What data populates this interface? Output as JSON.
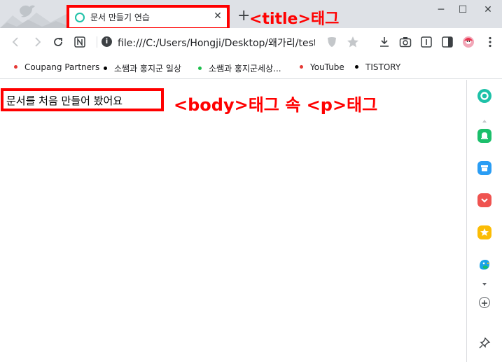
{
  "tab": {
    "title": "문서 만들기 연습",
    "close": "✕"
  },
  "new_tab": "+",
  "annotations": {
    "title_tag": "<title>태그",
    "body_tag": "<body>태그 속 <p>태그"
  },
  "window": {
    "minimize": "─",
    "maximize": "☐",
    "close": "✕"
  },
  "toolbar": {
    "url": "file:///C:/Users/Hongji/Desktop/왜가리/test.h"
  },
  "bookmarks": [
    {
      "label": "Coupang Partners",
      "color": "#e53935"
    },
    {
      "label": "소쌤과 홍지군 일상",
      "color": "#000000"
    },
    {
      "label": "소쌤과 홍지군세상...",
      "color": "#1bbf4b"
    },
    {
      "label": "YouTube",
      "color": "#e53935"
    },
    {
      "label": "TISTORY",
      "color": "#000000"
    }
  ],
  "content": {
    "paragraph": "문서를 처음 만들어 봤어요"
  },
  "colors": {
    "annotation_red": "#ff0000",
    "teal": "#1ec1a8"
  }
}
